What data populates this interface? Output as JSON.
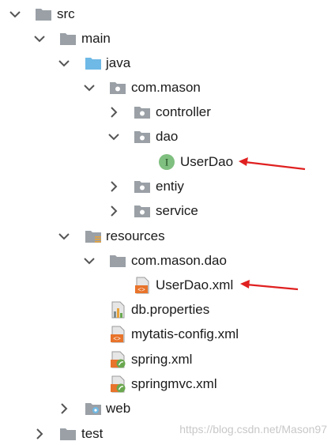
{
  "colors": {
    "folder": "#9aa0a6",
    "source_folder": "#6eb9e6",
    "interface_green": "#7fbf7f",
    "xml_orange": "#e8732a",
    "spring_green": "#6aa84f",
    "arrow_red": "#e02020",
    "watermark": "#c8c8c8"
  },
  "tree": {
    "src": {
      "label": "src",
      "icon": "folder-icon"
    },
    "main": {
      "label": "main",
      "icon": "folder-icon"
    },
    "java": {
      "label": "java",
      "icon": "source-folder-icon"
    },
    "com_mason": {
      "label": "com.mason",
      "icon": "package-icon"
    },
    "controller": {
      "label": "controller",
      "icon": "package-icon"
    },
    "dao": {
      "label": "dao",
      "icon": "package-icon"
    },
    "userdao": {
      "label": "UserDao",
      "icon": "interface-icon",
      "icon_letter": "I"
    },
    "entiy": {
      "label": "entiy",
      "icon": "package-icon"
    },
    "service": {
      "label": "service",
      "icon": "package-icon"
    },
    "resources": {
      "label": "resources",
      "icon": "resources-folder-icon"
    },
    "com_mason_dao": {
      "label": "com.mason.dao",
      "icon": "package-icon"
    },
    "userdao_xml": {
      "label": "UserDao.xml",
      "icon": "xml-file-icon"
    },
    "db_properties": {
      "label": "db.properties",
      "icon": "properties-file-icon"
    },
    "mytatis_config": {
      "label": "mytatis-config.xml",
      "icon": "xml-file-icon"
    },
    "spring_xml": {
      "label": "spring.xml",
      "icon": "spring-xml-icon"
    },
    "springmvc_xml": {
      "label": "springmvc.xml",
      "icon": "spring-xml-icon"
    },
    "web": {
      "label": "web",
      "icon": "web-folder-icon"
    },
    "test": {
      "label": "test",
      "icon": "folder-icon"
    }
  },
  "watermark": "https://blog.csdn.net/Mason97"
}
